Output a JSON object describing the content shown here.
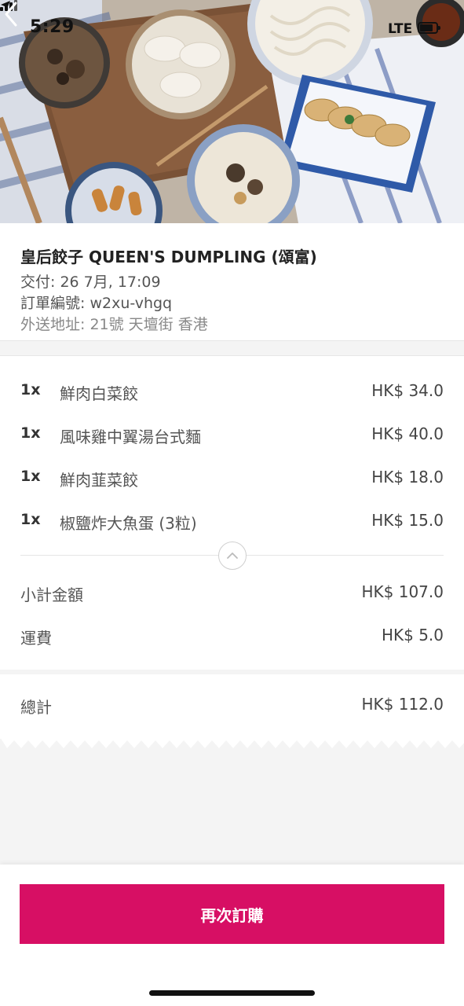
{
  "status_bar": {
    "time": "5:29",
    "network": "LTE"
  },
  "restaurant": {
    "name": "皇后餃子 QUEEN'S DUMPLING (頌富)",
    "delivery": "交付: 26 7月, 17:09",
    "order_number": "訂單編號: w2xu-vhgq",
    "address": "外送地址: 21號 天壇街 香港"
  },
  "items": [
    {
      "qty": "1x",
      "name": "鮮肉白菜餃",
      "price": "HK$ 34.0"
    },
    {
      "qty": "1x",
      "name": "風味雞中翼湯台式麵",
      "price": "HK$ 40.0"
    },
    {
      "qty": "1x",
      "name": "鮮肉韮菜餃",
      "price": "HK$ 18.0"
    },
    {
      "qty": "1x",
      "name": "椒鹽炸大魚蛋 (3粒)",
      "price": "HK$ 15.0"
    }
  ],
  "summary": {
    "subtotal_label": "小計金額",
    "subtotal_value": "HK$ 107.0",
    "delivery_fee_label": "運費",
    "delivery_fee_value": "HK$ 5.0",
    "total_label": "總計",
    "total_value": "HK$ 112.0"
  },
  "actions": {
    "reorder_label": "再次訂購"
  },
  "colors": {
    "accent": "#d70f64"
  },
  "icons": {
    "back": "chevron-left-icon",
    "collapse": "chevron-up-icon",
    "location": "location-arrow-icon"
  }
}
